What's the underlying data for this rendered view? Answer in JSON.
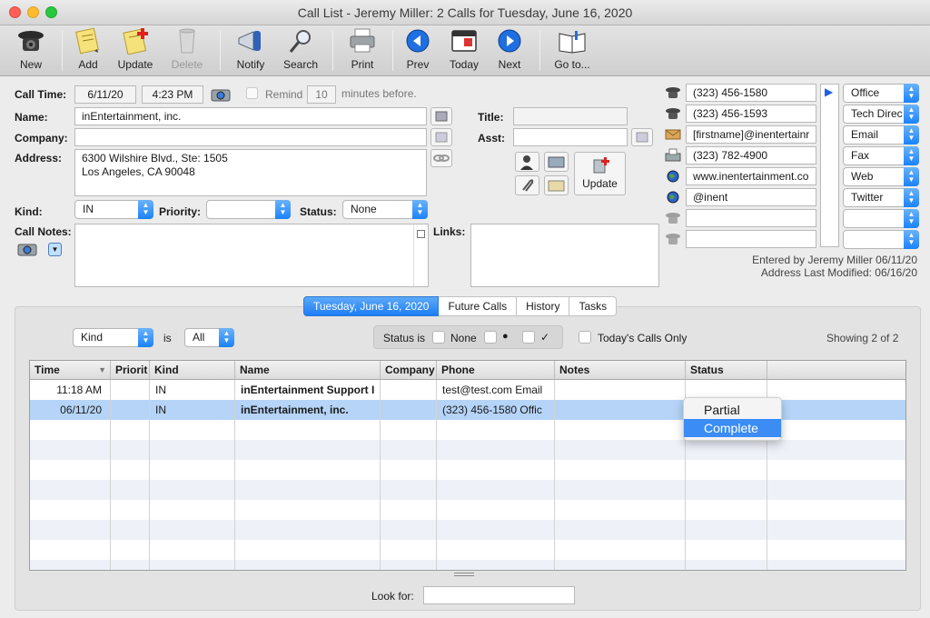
{
  "window": {
    "title": "Call List - Jeremy Miller: 2 Calls for Tuesday, June 16, 2020"
  },
  "toolbar": {
    "new": "New",
    "add": "Add",
    "update": "Update",
    "delete": "Delete",
    "notify": "Notify",
    "search": "Search",
    "print": "Print",
    "prev": "Prev",
    "today": "Today",
    "next": "Next",
    "goto": "Go to..."
  },
  "form": {
    "call_time_label": "Call Time:",
    "call_date": "6/11/20",
    "call_time": "4:23 PM",
    "remind_label": "Remind",
    "remind_minutes": "10",
    "minutes_before": "minutes before.",
    "name_label": "Name:",
    "name": "inEntertainment, inc.",
    "company_label": "Company:",
    "company": "",
    "address_label": "Address:",
    "address_line1": "6300 Wilshire Blvd., Ste: 1505",
    "address_line2": "Los Angeles, CA  90048",
    "title_label": "Title:",
    "asst_label": "Asst:",
    "update_button": "Update",
    "kind_label": "Kind:",
    "kind": "IN",
    "priority_label": "Priority:",
    "priority": "",
    "status_label": "Status:",
    "status": "None",
    "call_notes_label": "Call Notes:",
    "links_label": "Links:"
  },
  "contacts": [
    {
      "icon": "phone-icon",
      "value": "(323) 456-1580",
      "type": "Office"
    },
    {
      "icon": "phone-icon",
      "value": "(323) 456-1593",
      "type": "Tech Direc"
    },
    {
      "icon": "email-icon",
      "value": "[firstname]@inentertainr",
      "type": "Email"
    },
    {
      "icon": "fax-icon",
      "value": "(323) 782-4900",
      "type": "Fax"
    },
    {
      "icon": "globe-icon",
      "value": "www.inentertainment.co",
      "type": "Web"
    },
    {
      "icon": "globe-icon",
      "value": "@inent",
      "type": "Twitter"
    },
    {
      "icon": "phone-icon",
      "value": "",
      "type": ""
    },
    {
      "icon": "phone-icon",
      "value": "",
      "type": ""
    }
  ],
  "meta": {
    "entered_by": "Entered by  Jeremy Miller 06/11/20",
    "modified": "Address Last Modified: 06/16/20"
  },
  "tabs": [
    "Tuesday, June 16, 2020",
    "Future Calls",
    "History",
    "Tasks"
  ],
  "filter": {
    "kind": "Kind",
    "is": "is",
    "all": "All",
    "status_is": "Status is",
    "none": "None",
    "dot": "●",
    "check": "✓",
    "todays_only": "Today's Calls Only",
    "showing": "Showing 2 of 2"
  },
  "table": {
    "columns": [
      "Time",
      "Priorit",
      "Kind",
      "Name",
      "Company",
      "Phone",
      "Notes",
      "Status"
    ],
    "rows": [
      {
        "time": "11:18 AM",
        "priority": "",
        "kind": "IN",
        "name": "inEntertainment Support I",
        "company": "",
        "phone": "test@test.com Email",
        "notes": "",
        "status": ""
      },
      {
        "time": "06/11/20",
        "priority": "",
        "kind": "IN",
        "name": "inEntertainment, inc.",
        "company": "",
        "phone": "(323) 456-1580 Offic",
        "notes": "",
        "status": ""
      }
    ]
  },
  "status_menu": [
    "Partial",
    "Complete"
  ],
  "look_for": {
    "label": "Look for:",
    "value": ""
  }
}
